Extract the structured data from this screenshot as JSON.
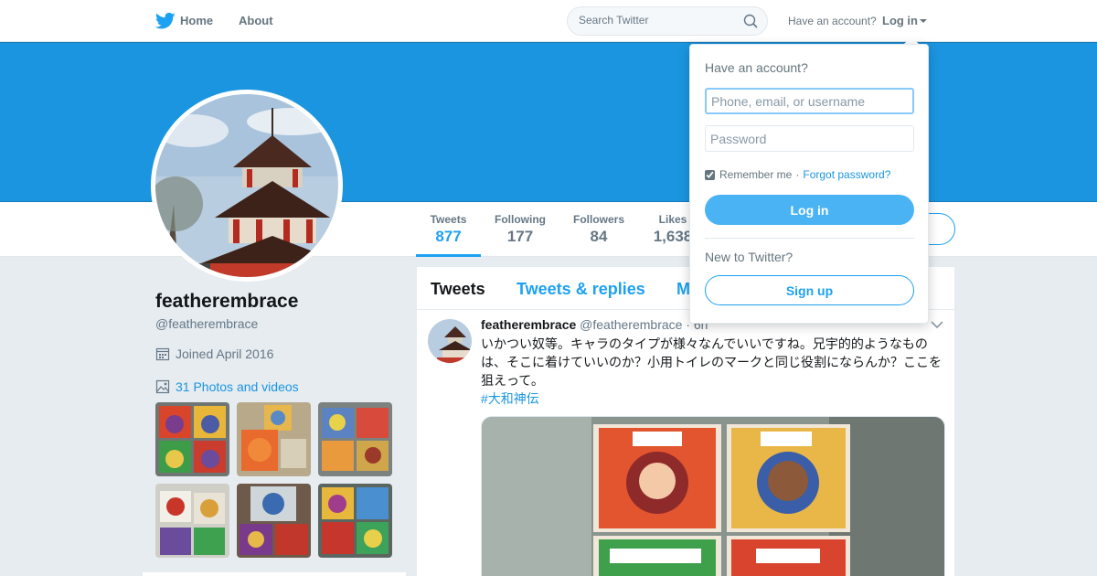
{
  "nav": {
    "home_label": "Home",
    "about_label": "About",
    "search_placeholder": "Search Twitter",
    "have_account": "Have an account?",
    "login_label": "Log in",
    "brand_color": "#1da1f2"
  },
  "banner": {
    "color": "#1b95e0"
  },
  "profile": {
    "name": "featherembrace",
    "handle": "@featherembrace",
    "joined": "Joined April 2016",
    "photos_label": "31 Photos and videos"
  },
  "stats": [
    {
      "label": "Tweets",
      "value": "877"
    },
    {
      "label": "Following",
      "value": "177"
    },
    {
      "label": "Followers",
      "value": "84"
    },
    {
      "label": "Likes",
      "value": "1,638"
    }
  ],
  "timeline": {
    "tabs": [
      {
        "label": "Tweets"
      },
      {
        "label": "Tweets & replies"
      },
      {
        "label": "M"
      }
    ],
    "tweet": {
      "name": "featherembrace",
      "handle": "@featherembrace",
      "time": "· 6h",
      "text": "いかつい奴等。キャラのタイプが様々なんでいいですね。兄宇的的ようなものは、そこに着けていいのか？小用トイレのマークと同じ役割にならんか？ここを狙えって。",
      "hashtag": "#大和神伝"
    }
  },
  "login_dropdown": {
    "title": "Have an account?",
    "username_placeholder": "Phone, email, or username",
    "password_placeholder": "Password",
    "remember_label": "Remember me",
    "separator": "·",
    "forgot_label": "Forgot password?",
    "login_button": "Log in",
    "new_label": "New to Twitter?",
    "signup_button": "Sign up"
  }
}
